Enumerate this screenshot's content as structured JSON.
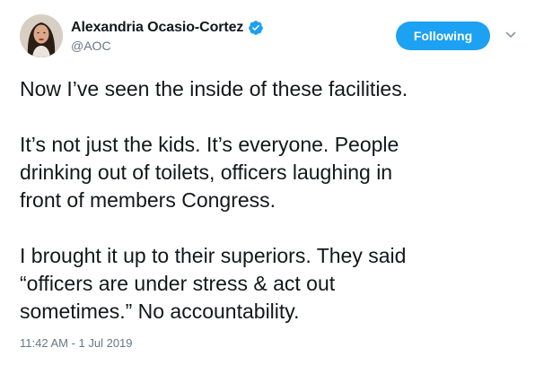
{
  "author": {
    "display_name": "Alexandria Ocasio-Cortez",
    "handle": "@AOC",
    "verified": true,
    "avatar_icon": "profile-photo",
    "verified_icon": "verified-badge-icon",
    "verified_color": "#1da1f2"
  },
  "follow_button": {
    "label": "Following",
    "color": "#1da1f2"
  },
  "menu": {
    "icon": "chevron-down-icon"
  },
  "tweet": {
    "lines": [
      "Now I’ve seen the inside of these facilities.",
      "",
      "It’s not just the kids. It’s everyone. People",
      "drinking out of toilets, officers laughing in",
      "front of members Congress.",
      "",
      "I brought it up to their superiors. They said",
      "“officers are under stress & act out",
      "sometimes.” No accountability."
    ],
    "timestamp": "11:42 AM - 1 Jul 2019"
  }
}
